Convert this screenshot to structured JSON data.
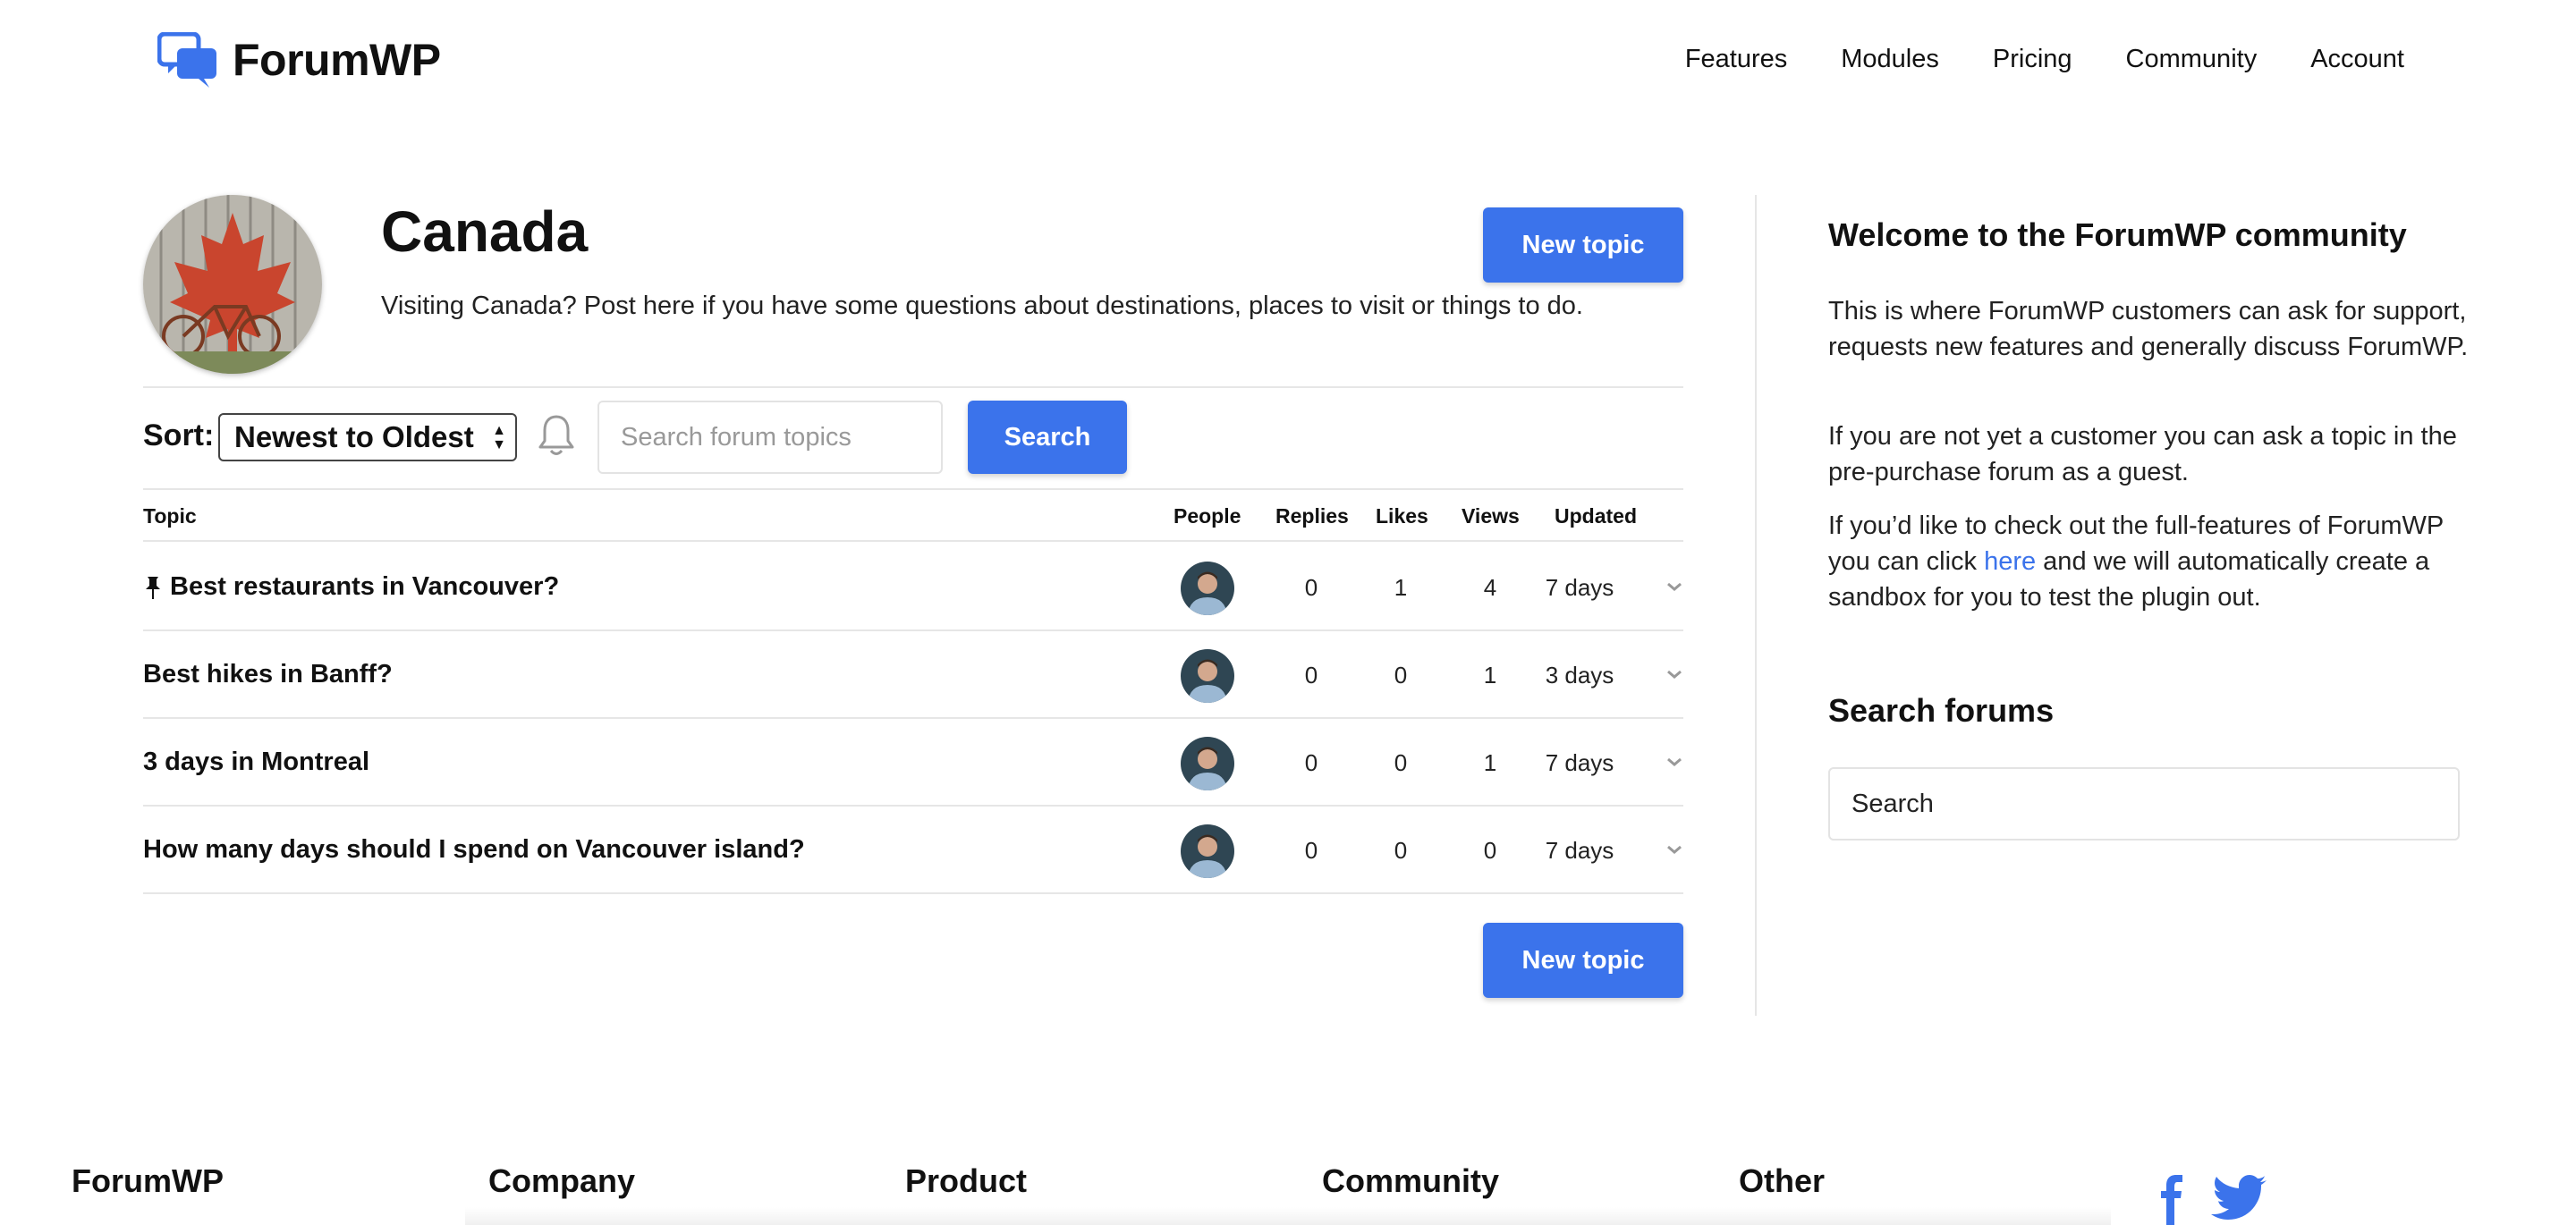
{
  "header": {
    "logo_text": "ForumWP",
    "nav": [
      "Features",
      "Modules",
      "Pricing",
      "Community",
      "Account"
    ]
  },
  "forum": {
    "title": "Canada",
    "description": "Visiting Canada? Post here if you have some questions about destinations, places to visit or things to do.",
    "new_topic_label": "New topic"
  },
  "toolbar": {
    "sort_label": "Sort:",
    "sort_value": "Newest to Oldest",
    "search_placeholder": "Search forum topics",
    "search_button": "Search"
  },
  "table": {
    "columns": [
      "Topic",
      "People",
      "Replies",
      "Likes",
      "Views",
      "Updated"
    ],
    "rows": [
      {
        "title": "Best restaurants in Vancouver?",
        "pinned": true,
        "replies": "0",
        "likes": "1",
        "views": "4",
        "updated": "7 days"
      },
      {
        "title": "Best hikes in Banff?",
        "pinned": false,
        "replies": "0",
        "likes": "0",
        "views": "1",
        "updated": "3 days"
      },
      {
        "title": "3 days in Montreal",
        "pinned": false,
        "replies": "0",
        "likes": "0",
        "views": "1",
        "updated": "7 days"
      },
      {
        "title": "How many days should I spend on Vancouver island?",
        "pinned": false,
        "replies": "0",
        "likes": "0",
        "views": "0",
        "updated": "7 days"
      }
    ]
  },
  "sidebar": {
    "welcome_title": "Welcome to the ForumWP community",
    "p1": "This is where ForumWP customers can ask for support, requests new features and generally discuss ForumWP.",
    "p2": "If you are not yet a customer you can ask a topic in the pre-purchase forum as a guest.",
    "p3_before": "If you’d like to check out the full-features of ForumWP you can click ",
    "p3_link": "here",
    "p3_after": " and we will automatically create a sandbox for you to test the plugin out.",
    "search_title": "Search forums",
    "search_value": "Search"
  },
  "footer": {
    "columns": [
      "ForumWP",
      "Company",
      "Product",
      "Community",
      "Other"
    ]
  },
  "colors": {
    "accent": "#3b73eb",
    "divider": "#e6e6e6"
  }
}
